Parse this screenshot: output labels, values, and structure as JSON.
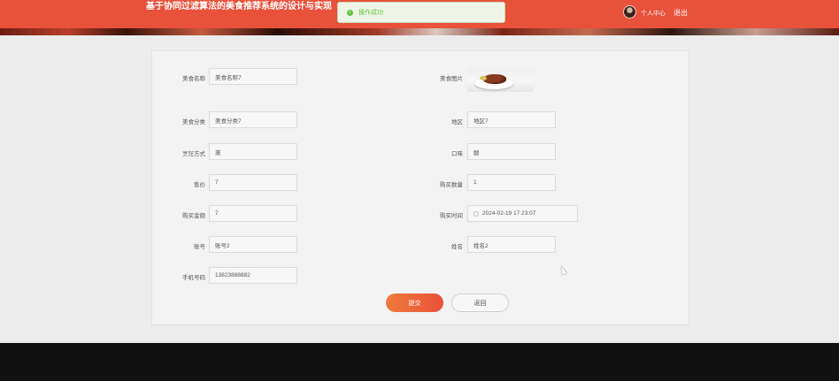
{
  "header": {
    "title": "基于协同过滤算法的美食推荐系统的设计与实现",
    "user_center": "个人中心",
    "logout": "退出",
    "accent_color": "#e8513a"
  },
  "toast": {
    "message": "操作成功",
    "icon": "check-circle-icon",
    "color": "#67c23a"
  },
  "form": {
    "food_name": {
      "label": "美食名称",
      "value": "美食名称7"
    },
    "food_image": {
      "label": "美食图片"
    },
    "category": {
      "label": "美食分类",
      "value": "美食分类7"
    },
    "region": {
      "label": "地区",
      "value": "地区7"
    },
    "cooking_method": {
      "label": "烹饪方式",
      "value": "蒸"
    },
    "taste": {
      "label": "口味",
      "value": "酸"
    },
    "price": {
      "label": "售价",
      "value": "7"
    },
    "quantity": {
      "label": "购买数量",
      "value": "1"
    },
    "amount": {
      "label": "购买金额",
      "value": "7"
    },
    "purchase_time": {
      "label": "购买时间",
      "value": "2024-02-19 17:23:07"
    },
    "account": {
      "label": "账号",
      "value": "账号2"
    },
    "name": {
      "label": "姓名",
      "value": "姓名2"
    },
    "phone": {
      "label": "手机号码",
      "value": "13823888882"
    }
  },
  "buttons": {
    "submit": "提交",
    "back": "返回"
  }
}
